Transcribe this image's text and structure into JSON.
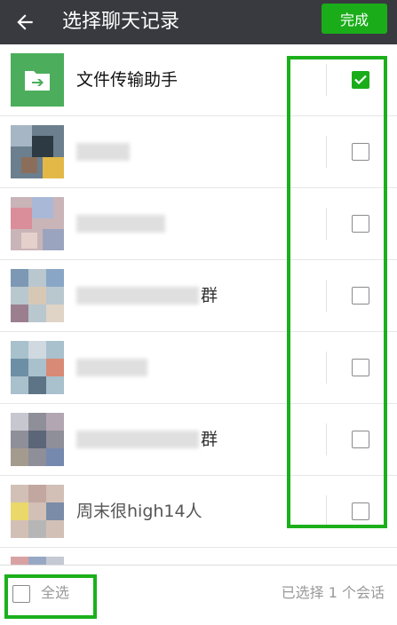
{
  "header": {
    "back_icon": "arrow-left-icon",
    "title": "选择聊天记录",
    "done_label": "完成"
  },
  "colors": {
    "header_bg": "#393a3f",
    "accent": "#1aad19",
    "highlight": "#1bb01b"
  },
  "chats": [
    {
      "name": "文件传输助手",
      "checked": true,
      "avatar": "file-transfer-icon"
    },
    {
      "name": "",
      "checked": false
    },
    {
      "name": "",
      "checked": false
    },
    {
      "name": "群",
      "checked": false
    },
    {
      "name": "",
      "checked": false
    },
    {
      "name": "群",
      "checked": false
    },
    {
      "name": "周末很high14人",
      "checked": false
    },
    {
      "name": "",
      "checked": false
    }
  ],
  "footer": {
    "select_all_label": "全选",
    "selected_count_text": "已选择 1 个会话"
  }
}
